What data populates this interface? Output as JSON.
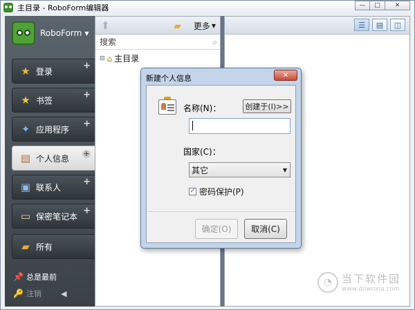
{
  "window": {
    "title": "主目录 - RoboForm编辑器",
    "controls": [
      "—",
      "□",
      "✕"
    ]
  },
  "sidebar": {
    "brand": "RoboForm",
    "items": [
      {
        "label": "登录",
        "icon": "login-icon"
      },
      {
        "label": "书签",
        "icon": "bookmark-star-icon"
      },
      {
        "label": "应用程序",
        "icon": "application-icon"
      },
      {
        "label": "个人信息",
        "icon": "identity-card-icon",
        "active": true
      },
      {
        "label": "联系人",
        "icon": "contacts-icon"
      },
      {
        "label": "保密笔记本",
        "icon": "safenote-icon"
      },
      {
        "label": "所有",
        "icon": "all-folder-icon"
      }
    ],
    "footer": {
      "recent": "总是最前",
      "logout": "注销"
    }
  },
  "tree_pane": {
    "more_label": "更多",
    "search_placeholder": "搜索",
    "root_label": "主目录"
  },
  "dialog": {
    "title": "新建个人信息",
    "name_label": "名称(N)：",
    "create_in_label": "创建于(I)>>",
    "name_value": "",
    "country_label": "国家(C)：",
    "country_value": "其它",
    "password_protect_label": "密码保护(P)",
    "password_protect_checked": true,
    "ok_label": "确定(O)",
    "cancel_label": "取消(C)"
  },
  "watermark": {
    "text": "当下软件园",
    "url": "www.downxia.com"
  }
}
